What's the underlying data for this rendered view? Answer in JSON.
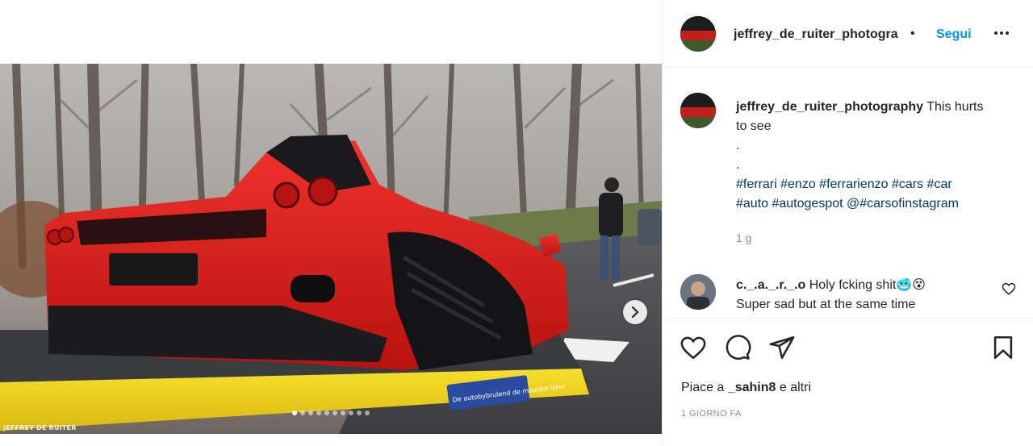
{
  "post": {
    "username": "jeffrey_de_ruiter_photogra",
    "separator": "•",
    "follow_label": "Segui",
    "more_icon": "more-horizontal-icon"
  },
  "media": {
    "watermark": "JEFFREY DE RUITER",
    "truck_text": "De autobybrulend de mooiste later",
    "slide_count": 10,
    "active_slide": 1
  },
  "caption": {
    "username": "jeffrey_de_ruiter_photography",
    "text_line1": "This hurts",
    "text_line2": "to see",
    "dot1": ".",
    "dot2": ".",
    "hashtags_line1": "#ferrari #enzo #ferrarienzo #cars #car",
    "hashtags_line2": "#auto #autogespot @#carsofinstagram",
    "time": "1 g"
  },
  "comment": {
    "username": "c._.a._.r._.o",
    "text_line1": "Holy fcking shit🥶😵",
    "text_line2": "Super sad but at the same time"
  },
  "likes": {
    "prefix": "Piace a",
    "user": "_sahin8",
    "suffix": "e altri"
  },
  "date": "1 GIORNO FA",
  "colors": {
    "link_blue": "#0095f6",
    "hashtag_blue": "#00376b",
    "ferrari_red": "#e0201c",
    "truck_yellow": "#f2d21c"
  }
}
